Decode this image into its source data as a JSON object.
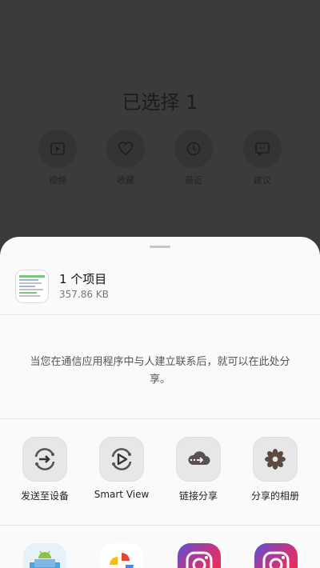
{
  "background": {
    "title": "已选择 1",
    "icons": [
      {
        "icon": "play-icon",
        "label": "视频"
      },
      {
        "icon": "heart-icon",
        "label": "收藏"
      },
      {
        "icon": "clock-icon",
        "label": "最近"
      },
      {
        "icon": "suggestion-icon",
        "label": "建议"
      }
    ]
  },
  "share_sheet": {
    "item": {
      "title": "1 个项目",
      "size": "357.86 KB"
    },
    "message": "当您在通信应用程序中与人建立联系后，就可以在此处分享。",
    "actions": [
      {
        "icon": "send-to-device-icon",
        "label": "发送至设备"
      },
      {
        "icon": "smart-view-icon",
        "label": "Smart View"
      },
      {
        "icon": "link-share-icon",
        "label": "链接分享"
      },
      {
        "icon": "shared-album-icon",
        "label": "分享的相册"
      }
    ],
    "apps": [
      {
        "icon": "android-app-icon"
      },
      {
        "icon": "photos-app-icon"
      },
      {
        "icon": "instagram-icon"
      },
      {
        "icon": "instagram-icon"
      }
    ]
  }
}
